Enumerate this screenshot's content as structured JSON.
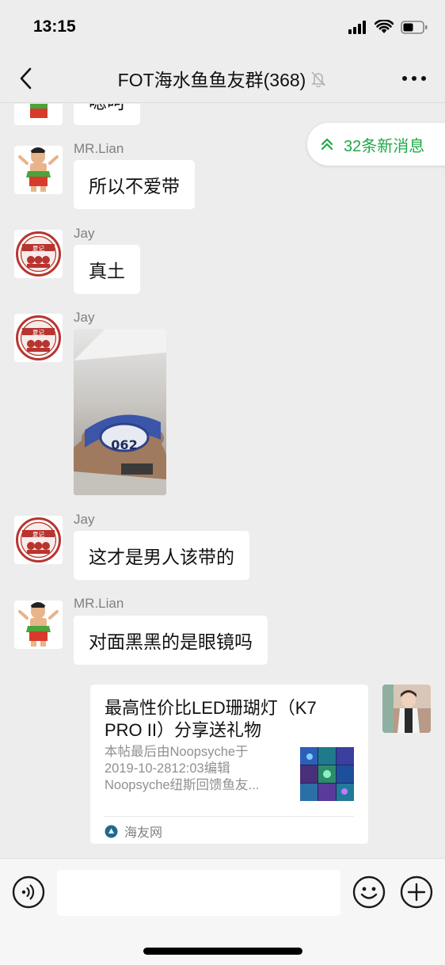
{
  "status_bar": {
    "time": "13:15"
  },
  "nav": {
    "title": "FOT海水鱼鱼友群(368)"
  },
  "new_messages": {
    "label": "32条新消息"
  },
  "messages": [
    {
      "sender": "",
      "text": "嗯呵"
    },
    {
      "sender": "MR.Lian",
      "text": "所以不爱带"
    },
    {
      "sender": "Jay",
      "text": "真土"
    },
    {
      "sender": "Jay",
      "photo_band_text": "062"
    },
    {
      "sender": "Jay",
      "text": "这才是男人该带的"
    },
    {
      "sender": "MR.Lian",
      "text": "对面黑黑的是眼镜吗"
    }
  ],
  "avatars": {
    "jay_logo_text": "夏记"
  },
  "link_card": {
    "title": "最高性价比LED珊瑚灯（K7 PRO II）分享送礼物",
    "desc_lines": [
      "本帖最后由Noopsyche于",
      "2019-10-2812:03编辑",
      "Noopsyche纽斯回馈鱼友..."
    ],
    "source": "海友网"
  },
  "input": {
    "placeholder": ""
  },
  "colors": {
    "accent_green": "#20a848",
    "background": "#ededed",
    "bubble": "#ffffff"
  }
}
